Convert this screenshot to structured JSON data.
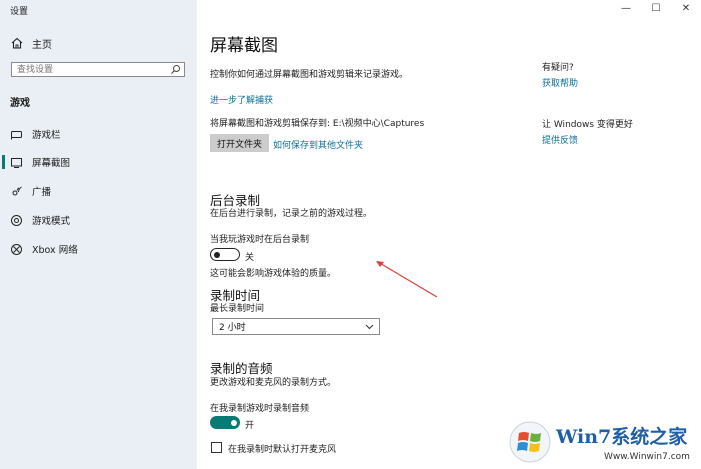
{
  "window": {
    "title": "设置",
    "controls": [
      "—",
      "☐",
      "✕"
    ]
  },
  "sidebar": {
    "home_label": "主页",
    "search_placeholder": "查找设置",
    "section_label": "游戏",
    "items": [
      {
        "label": "游戏栏",
        "icon": "gamebar-icon"
      },
      {
        "label": "屏幕截图",
        "icon": "capture-icon",
        "active": true
      },
      {
        "label": "广播",
        "icon": "broadcast-icon"
      },
      {
        "label": "游戏模式",
        "icon": "gamemode-icon"
      },
      {
        "label": "Xbox 网络",
        "icon": "xbox-icon"
      }
    ]
  },
  "main": {
    "title": "屏幕截图",
    "description": "控制你如何通过屏幕截图和游戏剪辑来记录游戏。",
    "learn_more": "进一步了解捕获",
    "save_path_text": "将屏幕截图和游戏剪辑保存到: E:\\视频中心\\Captures",
    "open_folder_button": "打开文件夹",
    "how_save_link": "如何保存到其他文件夹",
    "bg_recording": {
      "heading": "后台录制",
      "description": "在后台进行录制，记录之前的游戏过程。",
      "toggle_label": "当我玩游戏时在后台录制",
      "toggle_state": "关",
      "note": "这可能会影响游戏体验的质量。"
    },
    "record_time": {
      "heading": "录制时间",
      "sub_label": "最长录制时间",
      "selected": "2 小时"
    },
    "audio": {
      "heading": "录制的音频",
      "description": "更改游戏和麦克风的录制方式。",
      "toggle_label": "在我录制游戏时录制音频",
      "toggle_state": "开",
      "checkbox_label": "在我录制时默认打开麦克风"
    }
  },
  "aside": {
    "question": "有疑问?",
    "get_help": "获取帮助",
    "improve": "让 Windows 变得更好",
    "feedback": "提供反馈"
  },
  "watermark": {
    "brand": "Win7系统之家",
    "url": "Www.Winwin7.com"
  },
  "colors": {
    "sidebar_bg": "#e9eff5",
    "accent": "#0a7a75",
    "link": "#0a6f9a",
    "arrow": "#d9403a"
  }
}
